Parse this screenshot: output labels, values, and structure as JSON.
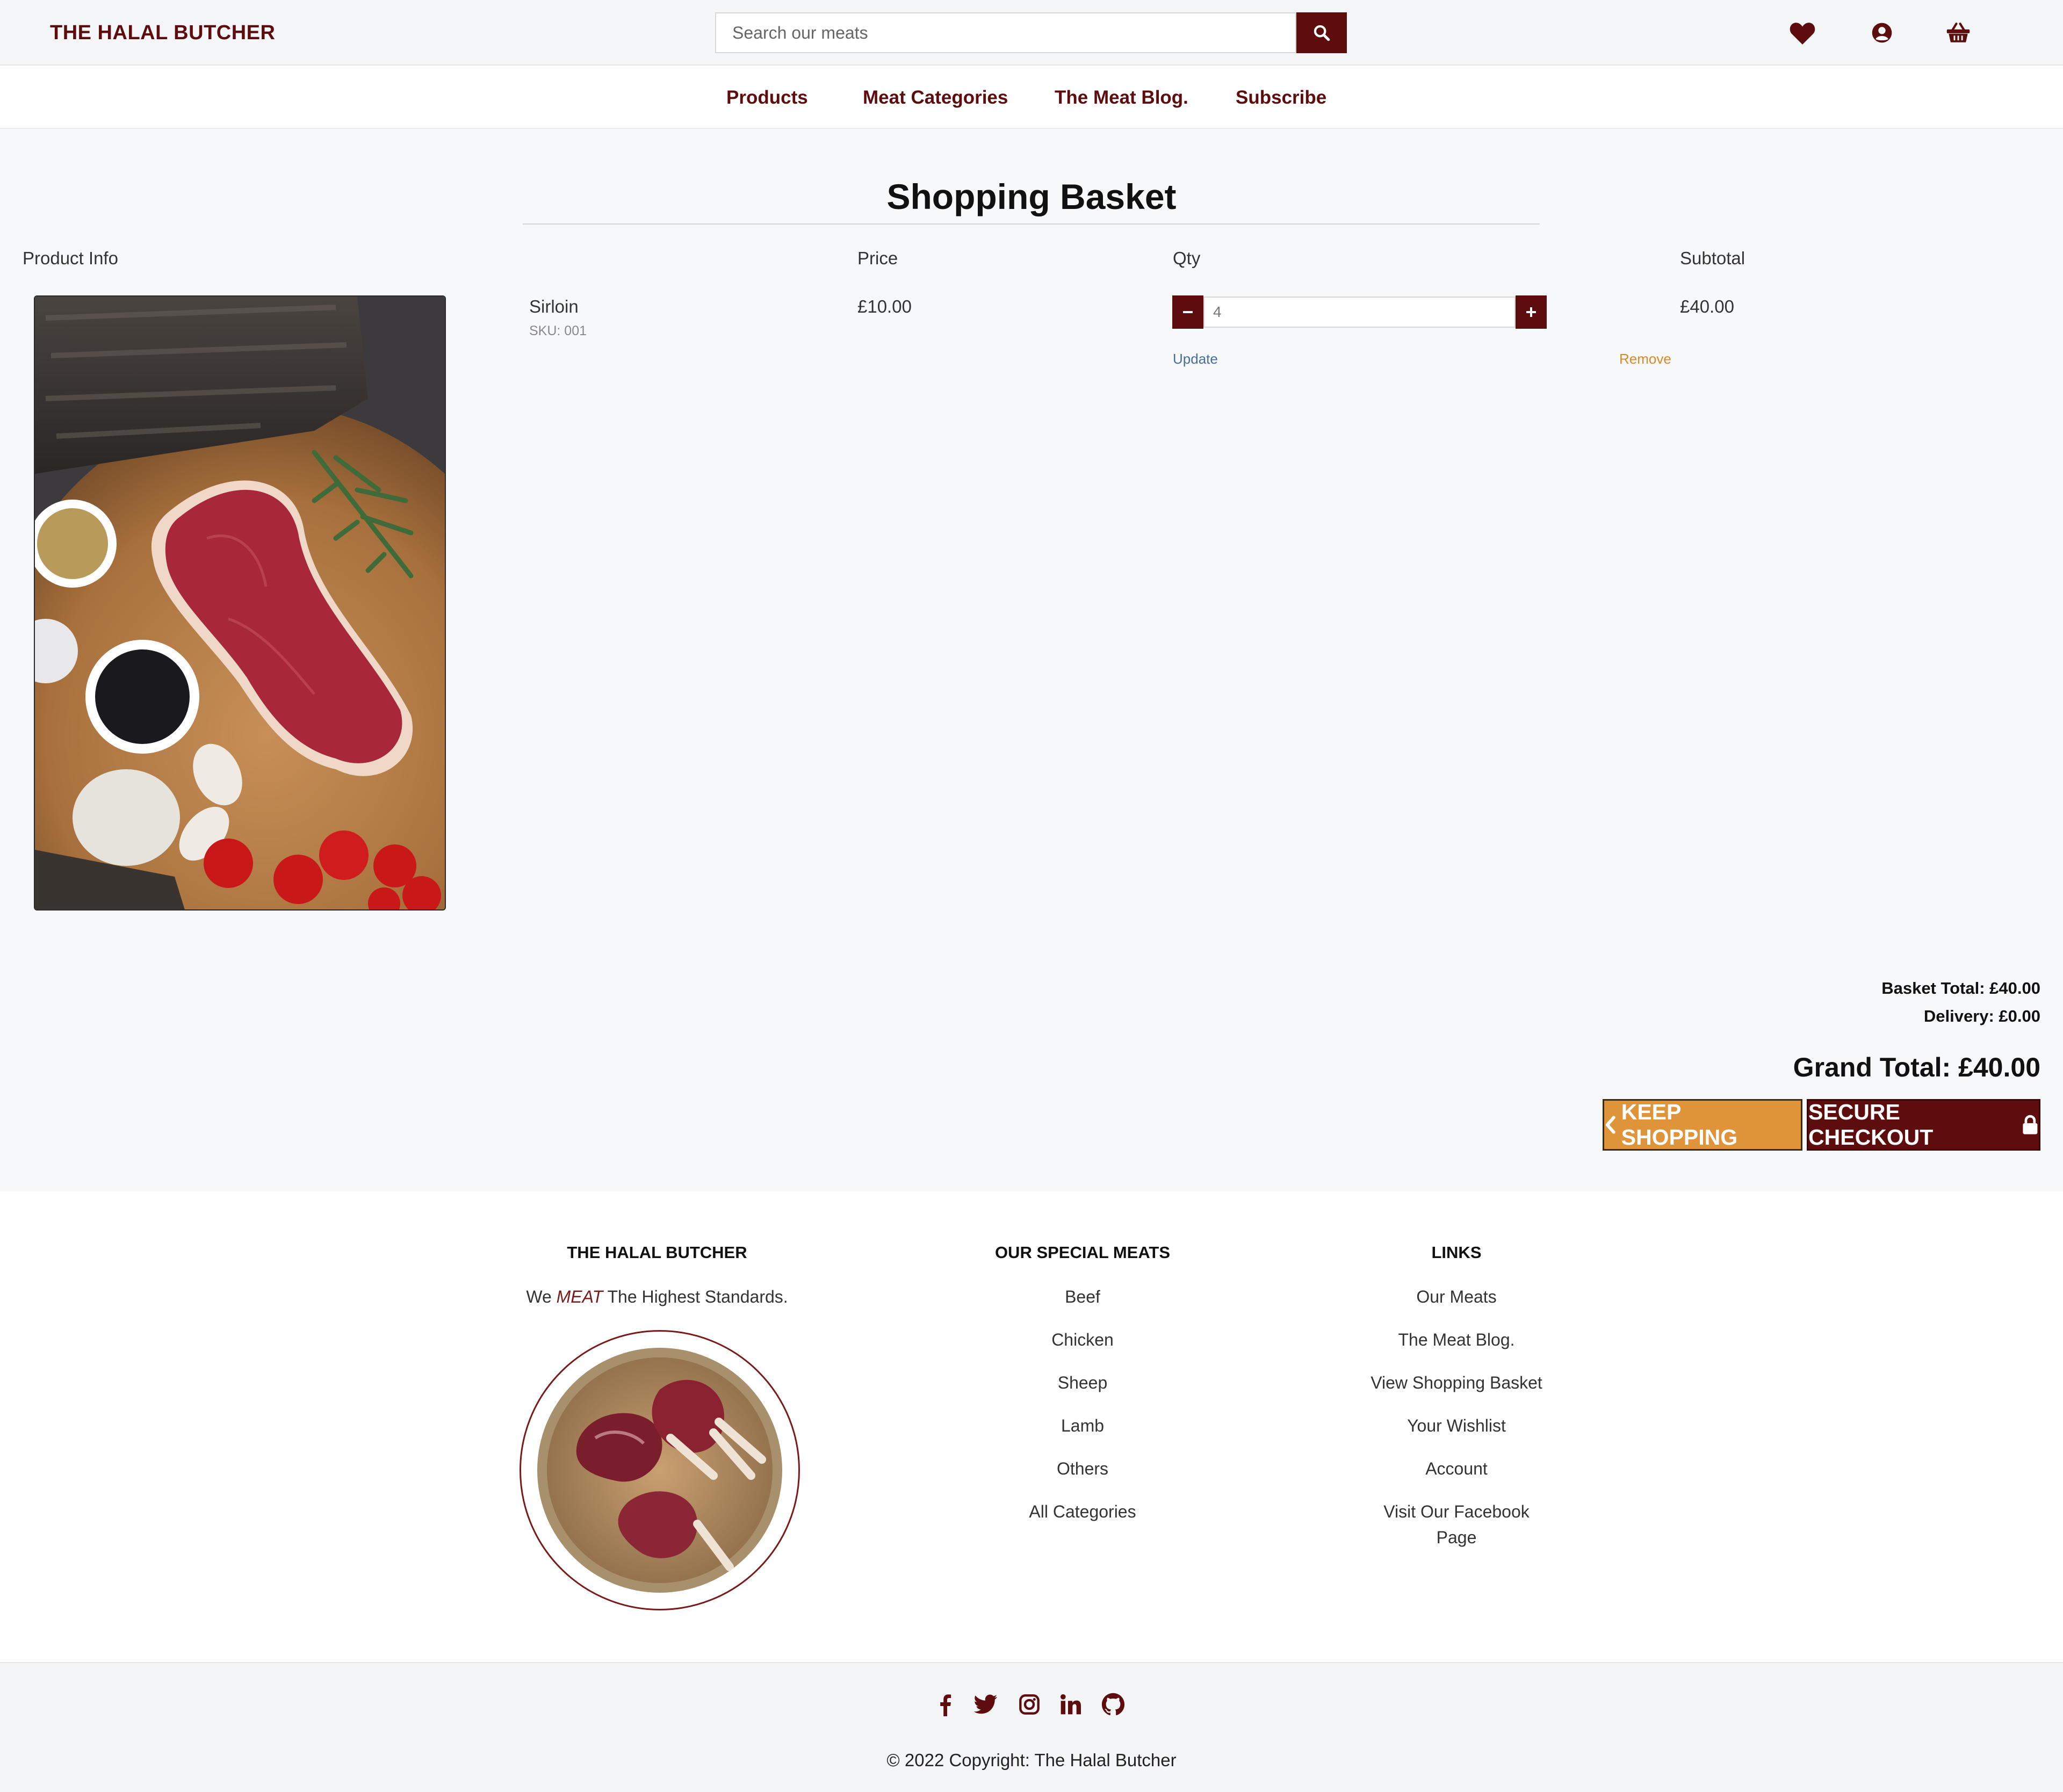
{
  "header": {
    "brand": "THE HALAL BUTCHER",
    "search_placeholder": "Search our meats",
    "icons": [
      "heart-icon",
      "account-icon",
      "basket-icon"
    ]
  },
  "nav": {
    "items": [
      {
        "label": "Products"
      },
      {
        "label": "Meat Categories"
      },
      {
        "label": "The Meat Blog."
      },
      {
        "label": "Subscribe"
      }
    ]
  },
  "basket": {
    "title": "Shopping Basket",
    "columns": {
      "product": "Product Info",
      "price": "Price",
      "qty": "Qty",
      "subtotal": "Subtotal"
    },
    "items": [
      {
        "name": "Sirloin",
        "sku": "SKU: 001",
        "price": "£10.00",
        "qty": "4",
        "subtotal": "£40.00",
        "update": "Update",
        "remove": "Remove"
      }
    ],
    "basket_total": "Basket Total: £40.00",
    "delivery": "Delivery: £0.00",
    "grand_total": "Grand Total: £40.00",
    "keep_shopping": "KEEP SHOPPING",
    "secure_checkout": "SECURE CHECKOUT"
  },
  "footer": {
    "col1": {
      "heading": "THE HALAL BUTCHER",
      "tag_pre": "We",
      "tag_em": "MEAT",
      "tag_post": "The Highest Standards."
    },
    "col2": {
      "heading": "OUR SPECIAL MEATS",
      "links": [
        "Beef",
        "Chicken",
        "Sheep",
        "Lamb",
        "Others",
        "All Categories"
      ]
    },
    "col3": {
      "heading": "LINKS",
      "links": [
        "Our Meats",
        "The Meat Blog.",
        "View Shopping Basket",
        "Your Wishlist",
        "Account",
        "Visit Our Facebook",
        "Page"
      ]
    },
    "social": [
      "facebook-icon",
      "twitter-icon",
      "instagram-icon",
      "linkedin-icon",
      "github-icon"
    ],
    "copyright": "© 2022 Copyright: The Halal Butcher"
  },
  "colors": {
    "brand": "#5d0d0d",
    "accent": "#df943a",
    "background": "#f7f8fa"
  }
}
